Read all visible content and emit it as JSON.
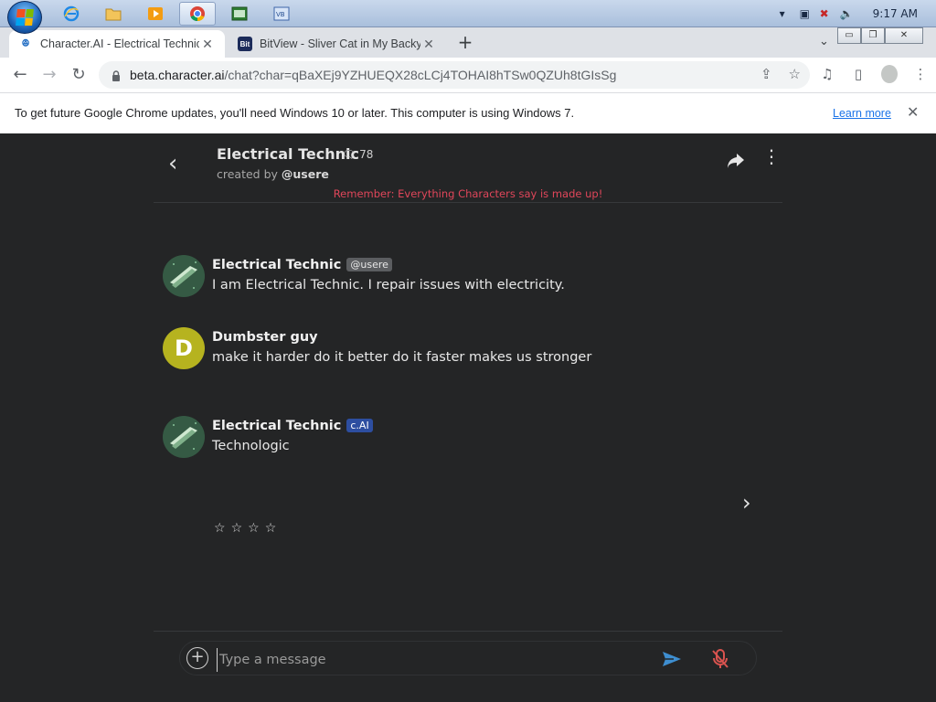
{
  "taskbar": {
    "clock": "9:17 AM"
  },
  "tabs": [
    {
      "title": "Character.AI - Electrical Technic",
      "active": true
    },
    {
      "title": "BitView - Sliver Cat in My Backya",
      "active": false
    }
  ],
  "address": {
    "host": "beta.character.ai",
    "path": "/chat?char=qBaXEj9YZHUEQX28cLCj4TOHAI8hTSw0QZUh8tGIsSg"
  },
  "infobar": {
    "message": "To get future Google Chrome updates, you'll need Windows 10 or later. This computer is using Windows 7.",
    "learn_more": "Learn more"
  },
  "chat": {
    "character_name": "Electrical Technic",
    "chat_count": "78",
    "created_by_prefix": "created by",
    "creator": "@usere",
    "reminder": "Remember: Everything Characters say is made up!"
  },
  "messages": [
    {
      "author": "Electrical Technic",
      "badge": "@usere",
      "text": "I am Electrical Technic. I repair issues with electricity."
    },
    {
      "author": "Dumbster guy",
      "initial": "D",
      "text": "make it harder do it better do it faster makes us stronger"
    },
    {
      "author": "Electrical Technic",
      "badge": "c.AI",
      "text": "Technologic"
    }
  ],
  "rating": {
    "stars": [
      "☆",
      "☆",
      "☆",
      "☆"
    ]
  },
  "composer": {
    "placeholder": "Type a message"
  },
  "colors": {
    "page_bg": "#242526",
    "reminder": "#e0465a",
    "send": "#3e8ed0",
    "mic_muted": "#d9534f",
    "user_avatar": "#b6b31f",
    "cai_badge": "#2d4ea0"
  },
  "icons": [
    "windows-start-icon",
    "ie-icon",
    "folder-icon",
    "media-player-icon",
    "chrome-icon",
    "terminal-icon",
    "vb-icon",
    "back-arrow-icon",
    "reload-icon",
    "lock-icon",
    "share-page-icon",
    "star-bookmark-icon",
    "media-queue-icon",
    "side-panel-icon",
    "profile-icon",
    "kebab-menu-icon",
    "share-arrow-icon",
    "chat-bubble-icon",
    "chevron-right-icon",
    "plus-circle-icon",
    "send-icon",
    "mic-off-icon"
  ]
}
